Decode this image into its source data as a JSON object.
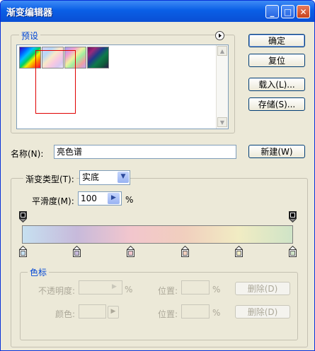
{
  "window": {
    "title": "渐变编辑器",
    "controls": {
      "minimize": "_",
      "maximize": "□",
      "close": "✕"
    }
  },
  "presets": {
    "legend": "预设",
    "menu_icon": "arrow-right-circle-icon",
    "swatches": [
      {
        "name": "spectrum"
      },
      {
        "name": "transparent-rainbow"
      },
      {
        "name": "pastel-rainbow"
      },
      {
        "name": "dark-spectrum"
      }
    ]
  },
  "buttons": {
    "ok": "确定",
    "reset": "复位",
    "load": "载入(L)...",
    "save": "存储(S)...",
    "new": "新建(W)",
    "delete_opacity": "删除(D)",
    "delete_color": "删除(D)"
  },
  "name_field": {
    "label": "名称(N):",
    "value": "亮色谱"
  },
  "gradient": {
    "type_label": "渐变类型(T):",
    "type_value": "实底",
    "smoothness_label": "平滑度(M):",
    "smoothness_value": "100",
    "smoothness_unit": "%",
    "colors": [
      "#c6e0f0",
      "#c7badb",
      "#f2c6cd",
      "#f1cfbe",
      "#f1ecc3",
      "#cfe4c7"
    ]
  },
  "stops": {
    "legend": "色标",
    "opacity_label": "不透明度:",
    "opacity_unit": "%",
    "color_label": "颜色:",
    "location_label_1": "位置:",
    "location_unit_1": "%",
    "location_label_2": "位置:",
    "location_unit_2": "%"
  }
}
